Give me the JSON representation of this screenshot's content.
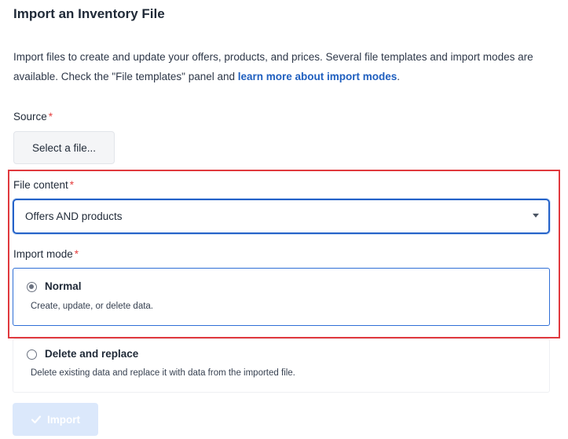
{
  "page": {
    "title": "Import an Inventory File",
    "intro_text": "Import files to create and update your offers, products, and prices. Several file templates and import modes are available. Check the \"File templates\" panel and ",
    "intro_link": "learn more about import modes",
    "intro_end": "."
  },
  "source": {
    "label": "Source",
    "required_mark": "*",
    "button_label": "Select a file..."
  },
  "file_content": {
    "label": "File content",
    "required_mark": "*",
    "selected_value": "Offers AND products"
  },
  "import_mode": {
    "label": "Import mode",
    "required_mark": "*",
    "options": [
      {
        "title": "Normal",
        "description": "Create, update, or delete data.",
        "selected": true
      },
      {
        "title": "Delete and replace",
        "description": "Delete existing data and replace it with data from the imported file.",
        "selected": false
      }
    ]
  },
  "actions": {
    "import_label": "Import",
    "import_icon": "check-icon"
  },
  "colors": {
    "highlight_border": "#e0393e",
    "accent": "#2563c9",
    "required": "#e53e3e",
    "import_disabled_bg": "#dbe8fb"
  }
}
